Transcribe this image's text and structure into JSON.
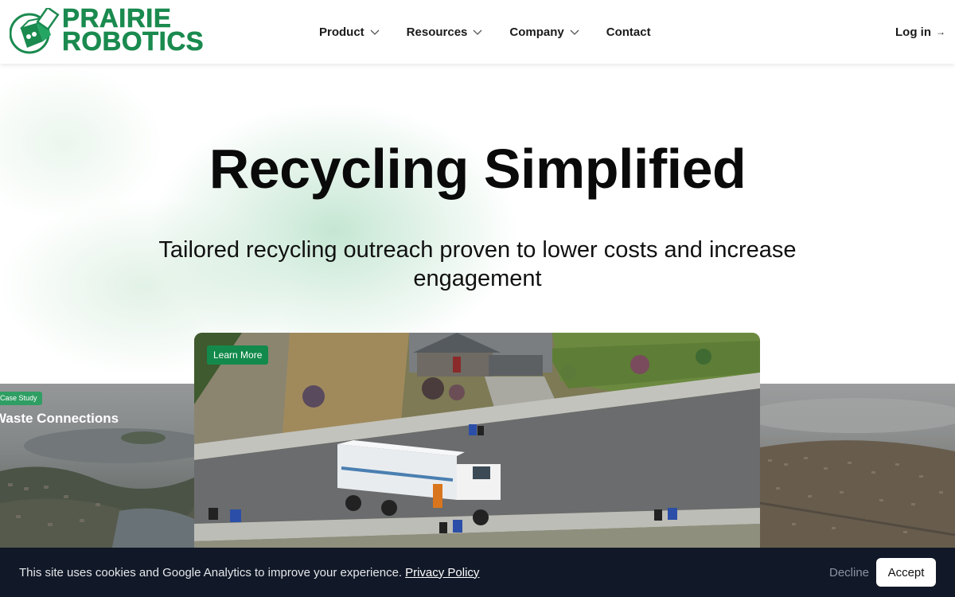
{
  "brand": {
    "name_line1": "PRAIRIE",
    "name_line2": "ROBOTICS",
    "color": "#1a8a4f"
  },
  "nav": {
    "items": [
      {
        "label": "Product",
        "has_dropdown": true
      },
      {
        "label": "Resources",
        "has_dropdown": true
      },
      {
        "label": "Company",
        "has_dropdown": true
      },
      {
        "label": "Contact",
        "has_dropdown": false
      }
    ],
    "login_label": "Log in",
    "login_icon": "arrow-right-icon"
  },
  "hero": {
    "title": "Recycling Simplified",
    "subtitle": "Tailored recycling outreach proven to lower costs and increase engagement"
  },
  "carousel": {
    "left_card": {
      "badge": "Case Study",
      "title": "Waste Connections"
    },
    "main_card": {
      "button_label": "Learn More"
    }
  },
  "cookie_banner": {
    "text": "This site uses cookies and Google Analytics to improve your experience.",
    "link_label": "Privacy Policy",
    "decline_label": "Decline",
    "accept_label": "Accept",
    "background": "#111827"
  },
  "colors": {
    "accent": "#138a4b",
    "text": "#0a0a0a"
  }
}
